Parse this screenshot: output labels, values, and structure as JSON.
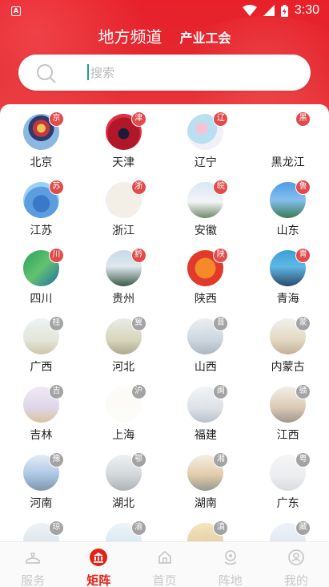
{
  "status_bar": {
    "time": "3:30",
    "app_icon_letter": "A"
  },
  "header": {
    "tab_local": "地方频道",
    "tab_industry": "产业工会"
  },
  "search": {
    "placeholder": "搜索"
  },
  "regions": [
    {
      "name": "北京",
      "badge": "京",
      "badge_color": "#e24b4b"
    },
    {
      "name": "天津",
      "badge": "津",
      "badge_color": "#e24b4b"
    },
    {
      "name": "辽宁",
      "badge": "辽",
      "badge_color": "#e24b4b"
    },
    {
      "name": "黑龙江",
      "badge": "黑",
      "badge_color": "#e24b4b"
    },
    {
      "name": "江苏",
      "badge": "苏",
      "badge_color": "#e24b4b"
    },
    {
      "name": "浙江",
      "badge": "浙",
      "badge_color": "#e24b4b"
    },
    {
      "name": "安徽",
      "badge": "皖",
      "badge_color": "#e24b4b"
    },
    {
      "name": "山东",
      "badge": "鲁",
      "badge_color": "#e24b4b"
    },
    {
      "name": "四川",
      "badge": "川",
      "badge_color": "#e24b4b"
    },
    {
      "name": "贵州",
      "badge": "黔",
      "badge_color": "#e24b4b"
    },
    {
      "name": "陕西",
      "badge": "陕",
      "badge_color": "#e24b4b"
    },
    {
      "name": "青海",
      "badge": "青",
      "badge_color": "#e24b4b"
    },
    {
      "name": "广西",
      "badge": "桂",
      "badge_color": "#7d7d7d"
    },
    {
      "name": "河北",
      "badge": "冀",
      "badge_color": "#7d7d7d"
    },
    {
      "name": "山西",
      "badge": "晋",
      "badge_color": "#7d7d7d"
    },
    {
      "name": "内蒙古",
      "badge": "蒙",
      "badge_color": "#7d7d7d"
    },
    {
      "name": "吉林",
      "badge": "吉",
      "badge_color": "#7d7d7d"
    },
    {
      "name": "上海",
      "badge": "沪",
      "badge_color": "#7d7d7d"
    },
    {
      "name": "福建",
      "badge": "闽",
      "badge_color": "#7d7d7d"
    },
    {
      "name": "江西",
      "badge": "赣",
      "badge_color": "#7d7d7d"
    },
    {
      "name": "河南",
      "badge": "豫",
      "badge_color": "#7d7d7d"
    },
    {
      "name": "湖北",
      "badge": "鄂",
      "badge_color": "#7d7d7d"
    },
    {
      "name": "湖南",
      "badge": "湘",
      "badge_color": "#7d7d7d"
    },
    {
      "name": "广东",
      "badge": "粤",
      "badge_color": "#7d7d7d"
    },
    {
      "name": "",
      "badge": "琼",
      "badge_color": "#7d7d7d"
    },
    {
      "name": "",
      "badge": "渝",
      "badge_color": "#7d7d7d"
    },
    {
      "name": "",
      "badge": "滇",
      "badge_color": "#7d7d7d"
    },
    {
      "name": "",
      "badge": "藏",
      "badge_color": "#7d7d7d"
    }
  ],
  "tabbar": [
    {
      "label": "服务",
      "icon": "service-icon",
      "active": false
    },
    {
      "label": "矩阵",
      "icon": "matrix-icon",
      "active": true
    },
    {
      "label": "首页",
      "icon": "home-icon",
      "active": false
    },
    {
      "label": "阵地",
      "icon": "location-icon",
      "active": false
    },
    {
      "label": "我的",
      "icon": "profile-icon",
      "active": false
    }
  ],
  "colors": {
    "primary_red": "#e2231a",
    "header_red": "#e32930",
    "inactive_gray": "#c8c8c8"
  }
}
